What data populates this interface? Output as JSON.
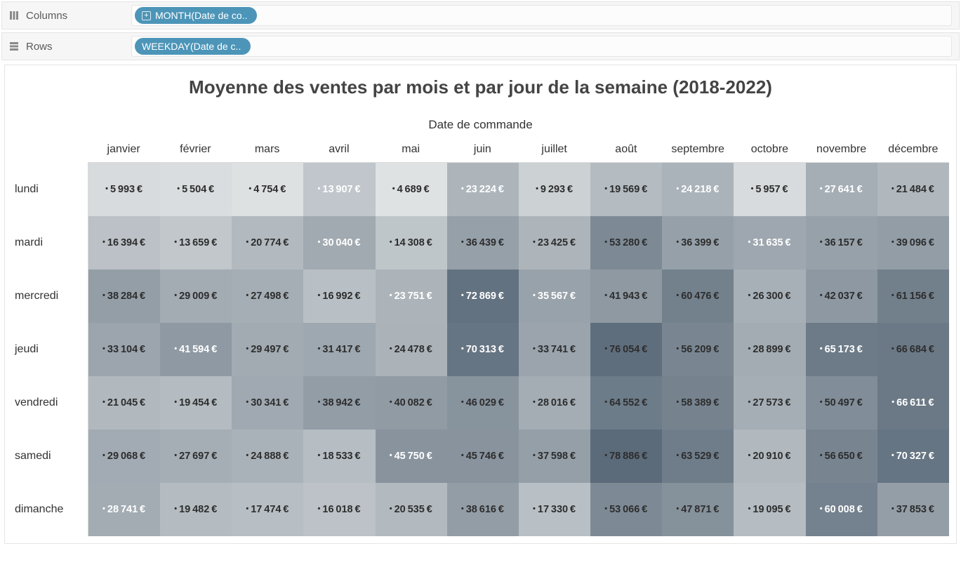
{
  "shelves": {
    "columns_label": "Columns",
    "rows_label": "Rows",
    "columns_pill": "MONTH(Date de co..",
    "rows_pill": "WEEKDAY(Date de c.."
  },
  "chart_data": {
    "type": "heatmap",
    "title": "Moyenne des ventes par mois et par jour de la semaine (2018-2022)",
    "axis_title": "Date de commande",
    "columns": [
      "janvier",
      "février",
      "mars",
      "avril",
      "mai",
      "juin",
      "juillet",
      "août",
      "septembre",
      "octobre",
      "novembre",
      "décembre"
    ],
    "rows": [
      "lundi",
      "mardi",
      "mercredi",
      "jeudi",
      "vendredi",
      "samedi",
      "dimanche"
    ],
    "currency_suffix": "€",
    "color_scale": {
      "min_color": "#dfe2e3",
      "max_color": "#5b6b7a"
    },
    "values": [
      [
        5993,
        5504,
        4754,
        13907,
        4689,
        23224,
        9293,
        19569,
        24218,
        5957,
        27641,
        21484
      ],
      [
        16394,
        13659,
        20774,
        30040,
        14308,
        36439,
        23425,
        53280,
        36399,
        31635,
        36157,
        39096
      ],
      [
        38284,
        29009,
        27498,
        16992,
        23751,
        72869,
        35567,
        41943,
        60476,
        26300,
        42037,
        61156
      ],
      [
        33104,
        41594,
        29497,
        31417,
        24478,
        70313,
        33741,
        76054,
        56209,
        28899,
        65173,
        66684
      ],
      [
        21045,
        19454,
        30341,
        38942,
        40082,
        46029,
        28016,
        64552,
        58389,
        27573,
        50497,
        66611
      ],
      [
        29068,
        27697,
        24888,
        18533,
        45750,
        45746,
        37598,
        78886,
        63529,
        20910,
        56650,
        70327
      ],
      [
        28741,
        19482,
        17474,
        16018,
        20535,
        38616,
        17330,
        53066,
        47871,
        19095,
        60008,
        37853
      ]
    ],
    "white_text_cells": [
      [
        0,
        3
      ],
      [
        0,
        5
      ],
      [
        0,
        8
      ],
      [
        0,
        10
      ],
      [
        1,
        3
      ],
      [
        1,
        9
      ],
      [
        2,
        4
      ],
      [
        2,
        5
      ],
      [
        2,
        6
      ],
      [
        3,
        1
      ],
      [
        3,
        5
      ],
      [
        3,
        10
      ],
      [
        4,
        11
      ],
      [
        5,
        4
      ],
      [
        5,
        11
      ],
      [
        6,
        0
      ],
      [
        6,
        10
      ]
    ]
  }
}
